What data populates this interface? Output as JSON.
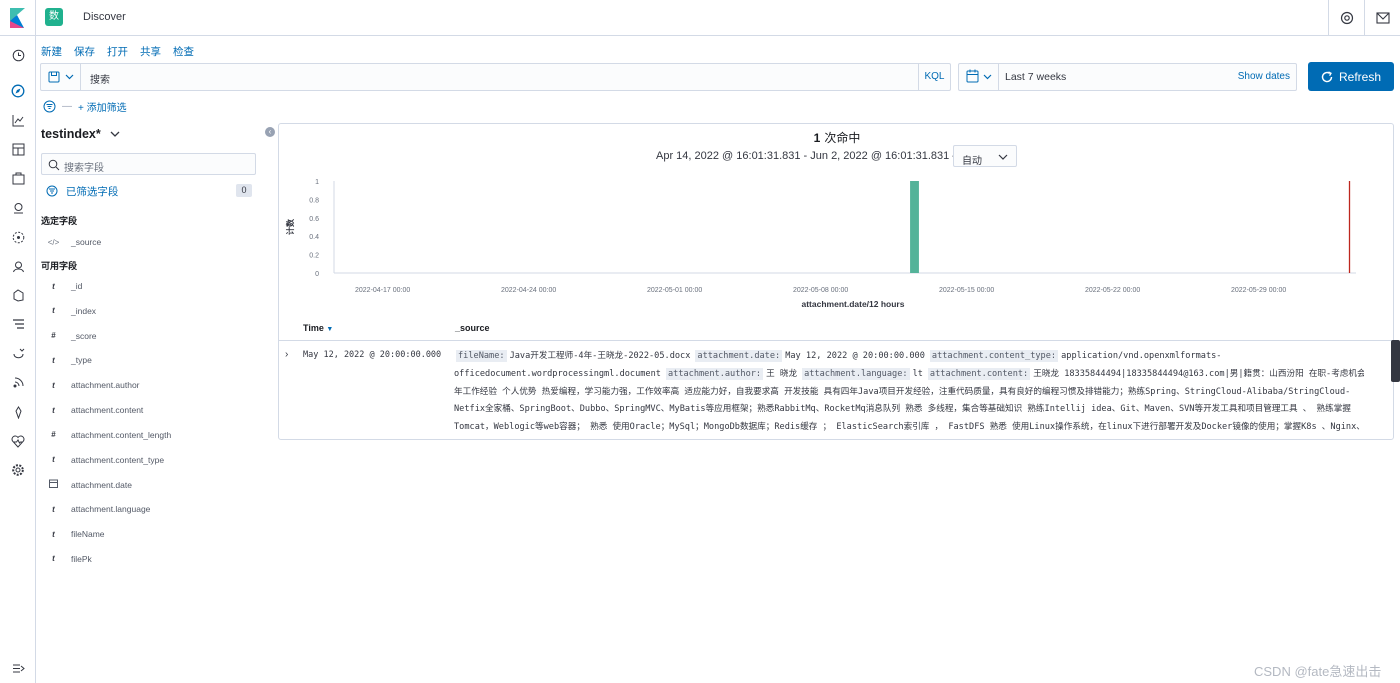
{
  "header": {
    "app_icon_text": "数",
    "breadcrumb": "Discover"
  },
  "menu": [
    "新建",
    "保存",
    "打开",
    "共享",
    "检查"
  ],
  "query": {
    "placeholder": "搜索",
    "language": "KQL"
  },
  "time": {
    "range": "Last 7 weeks",
    "show_dates": "Show dates"
  },
  "refresh_label": "Refresh",
  "filter": {
    "dashes": "—",
    "add": "+ 添加筛选"
  },
  "sidebar": {
    "index": "testindex*",
    "search_placeholder": "搜索字段",
    "filtered_label": "已筛选字段",
    "filtered_count": "0",
    "selected_title": "选定字段",
    "selected_fields": [
      {
        "type": "</>",
        "name": "_source"
      }
    ],
    "available_title": "可用字段",
    "available_fields": [
      {
        "type": "t",
        "name": "_id"
      },
      {
        "type": "t",
        "name": "_index"
      },
      {
        "type": "#",
        "name": "_score"
      },
      {
        "type": "t",
        "name": "_type"
      },
      {
        "type": "t",
        "name": "attachment.author"
      },
      {
        "type": "t",
        "name": "attachment.content"
      },
      {
        "type": "#",
        "name": "attachment.content_length"
      },
      {
        "type": "t",
        "name": "attachment.content_type"
      },
      {
        "type": "cal",
        "name": "attachment.date"
      },
      {
        "type": "t",
        "name": "attachment.language"
      },
      {
        "type": "t",
        "name": "fileName"
      },
      {
        "type": "t",
        "name": "filePk"
      }
    ]
  },
  "hits": {
    "count": "1",
    "label": "次命中"
  },
  "time_range_text": "Apr 14, 2022 @ 16:01:31.831 - Jun 2, 2022 @ 16:01:31.831 —",
  "interval": "自动",
  "chart_data": {
    "type": "bar",
    "ylabel": "计数",
    "xlabel": "attachment.date/12 hours",
    "ylim": [
      0,
      1
    ],
    "yticks": [
      "1",
      "0.8",
      "0.6",
      "0.4",
      "0.2",
      "0"
    ],
    "xticks": [
      "2022-04-17 00:00",
      "2022-04-24 00:00",
      "2022-05-01 00:00",
      "2022-05-08 00:00",
      "2022-05-15 00:00",
      "2022-05-22 00:00",
      "2022-05-29 00:00"
    ],
    "bars": [
      {
        "x": "2022-05-12 12:00",
        "value": 1
      }
    ],
    "bar_color": "#54b399",
    "now_marker_color": "#bd271e"
  },
  "table": {
    "col_time": "Time",
    "col_source": "_source",
    "row": {
      "time": "May 12, 2022 @ 20:00:00.000",
      "source_lines": [
        [
          {
            "k": "fileName:",
            "v": "Java开发工程师-4年-王晓龙-2022-05.docx"
          },
          {
            "k": "attachment.date:",
            "v": "May 12, 2022 @ 20:00:00.000"
          },
          {
            "k": "attachment.content_type:",
            "v": "application/vnd.openxmlformats-"
          }
        ],
        [
          {
            "k": "",
            "v": "officedocument.wordprocessingml.document"
          },
          {
            "k": "attachment.author:",
            "v": "王 晓龙"
          },
          {
            "k": "attachment.language:",
            "v": "lt"
          },
          {
            "k": "attachment.content:",
            "v": "王晓龙 18335844494|18335844494@163.com|男|籍贯：山西汾阳 在职-考虑机会|4"
          }
        ],
        [
          {
            "k": "",
            "v": "年工作经验 个人优势 热爱编程，学习能力强，工作效率高 适应能力好，自我要求高 开发技能 具有四年Java项目开发经验，注重代码质量，具有良好的编程习惯及排错能力；熟练Spring、StringCloud-Alibaba/StringCloud-"
          }
        ],
        [
          {
            "k": "",
            "v": "Netfix全家桶、SpringBoot、Dubbo、SpringMVC、MyBatis等应用框架；熟悉RabbitMq、RocketMq消息队列 熟悉 多线程，集合等基础知识 熟练Intellij idea、Git、Maven、SVN等开发工具和项目管理工具 、 熟练掌握"
          }
        ],
        [
          {
            "k": "",
            "v": "Tomcat，Weblogic等web容器； 熟悉 使用Oracle；MySql；MongoDb数据库；Redis缓存 ； ElasticSearch索引库 ， FastDFS 熟悉 使用Linux操作系统，在linux下进行部署开发及Docker镜像的使用；掌握K8s 、Nginx、"
          }
        ]
      ]
    }
  },
  "watermark": "CSDN @fate急速出击"
}
